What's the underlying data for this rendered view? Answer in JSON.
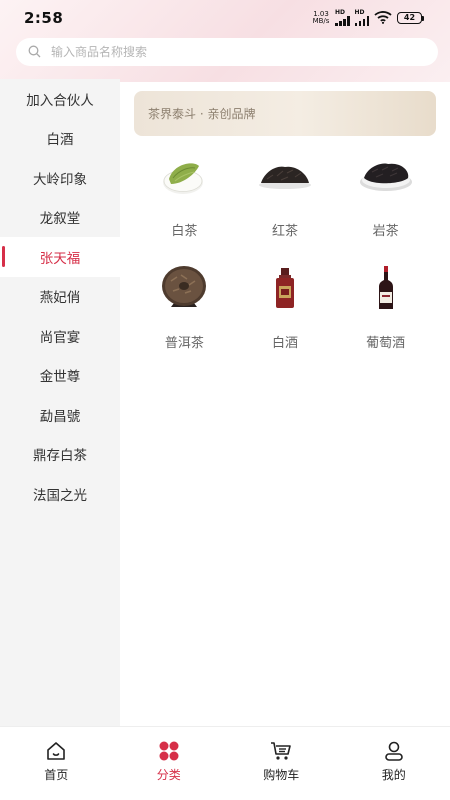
{
  "status_bar": {
    "time": "2:58",
    "net_speed": "1.03",
    "net_unit": "MB/s",
    "hd1": "HD",
    "hd2": "HD",
    "battery": "42"
  },
  "search": {
    "placeholder": "输入商品名称搜索"
  },
  "sidebar": {
    "active_index": 4,
    "items": [
      {
        "label": "加入合伙人"
      },
      {
        "label": "白酒"
      },
      {
        "label": "大岭印象"
      },
      {
        "label": "龙叙堂"
      },
      {
        "label": "张天福"
      },
      {
        "label": "燕妃俏"
      },
      {
        "label": "尚官宴"
      },
      {
        "label": "金世尊"
      },
      {
        "label": "勐昌號"
      },
      {
        "label": "鼎存白茶"
      },
      {
        "label": "法国之光"
      }
    ]
  },
  "banner": {
    "text": "茶界泰斗 · 亲创品牌"
  },
  "products": [
    {
      "label": "白茶",
      "icon": "white-tea-icon"
    },
    {
      "label": "红茶",
      "icon": "black-tea-icon"
    },
    {
      "label": "岩茶",
      "icon": "rock-tea-icon"
    },
    {
      "label": "普洱茶",
      "icon": "puer-cake-icon"
    },
    {
      "label": "白酒",
      "icon": "baijiu-bottle-icon"
    },
    {
      "label": "葡萄酒",
      "icon": "wine-bottle-icon"
    }
  ],
  "tabbar": {
    "active": "category",
    "items": [
      {
        "label": "首页",
        "icon": "home-icon"
      },
      {
        "label": "分类",
        "icon": "category-icon"
      },
      {
        "label": "购物车",
        "icon": "cart-icon"
      },
      {
        "label": "我的",
        "icon": "profile-icon"
      }
    ]
  },
  "colors": {
    "accent": "#d62f48",
    "sidebar_bg": "#f4f4f4",
    "banner_text": "#8c7f6e"
  }
}
